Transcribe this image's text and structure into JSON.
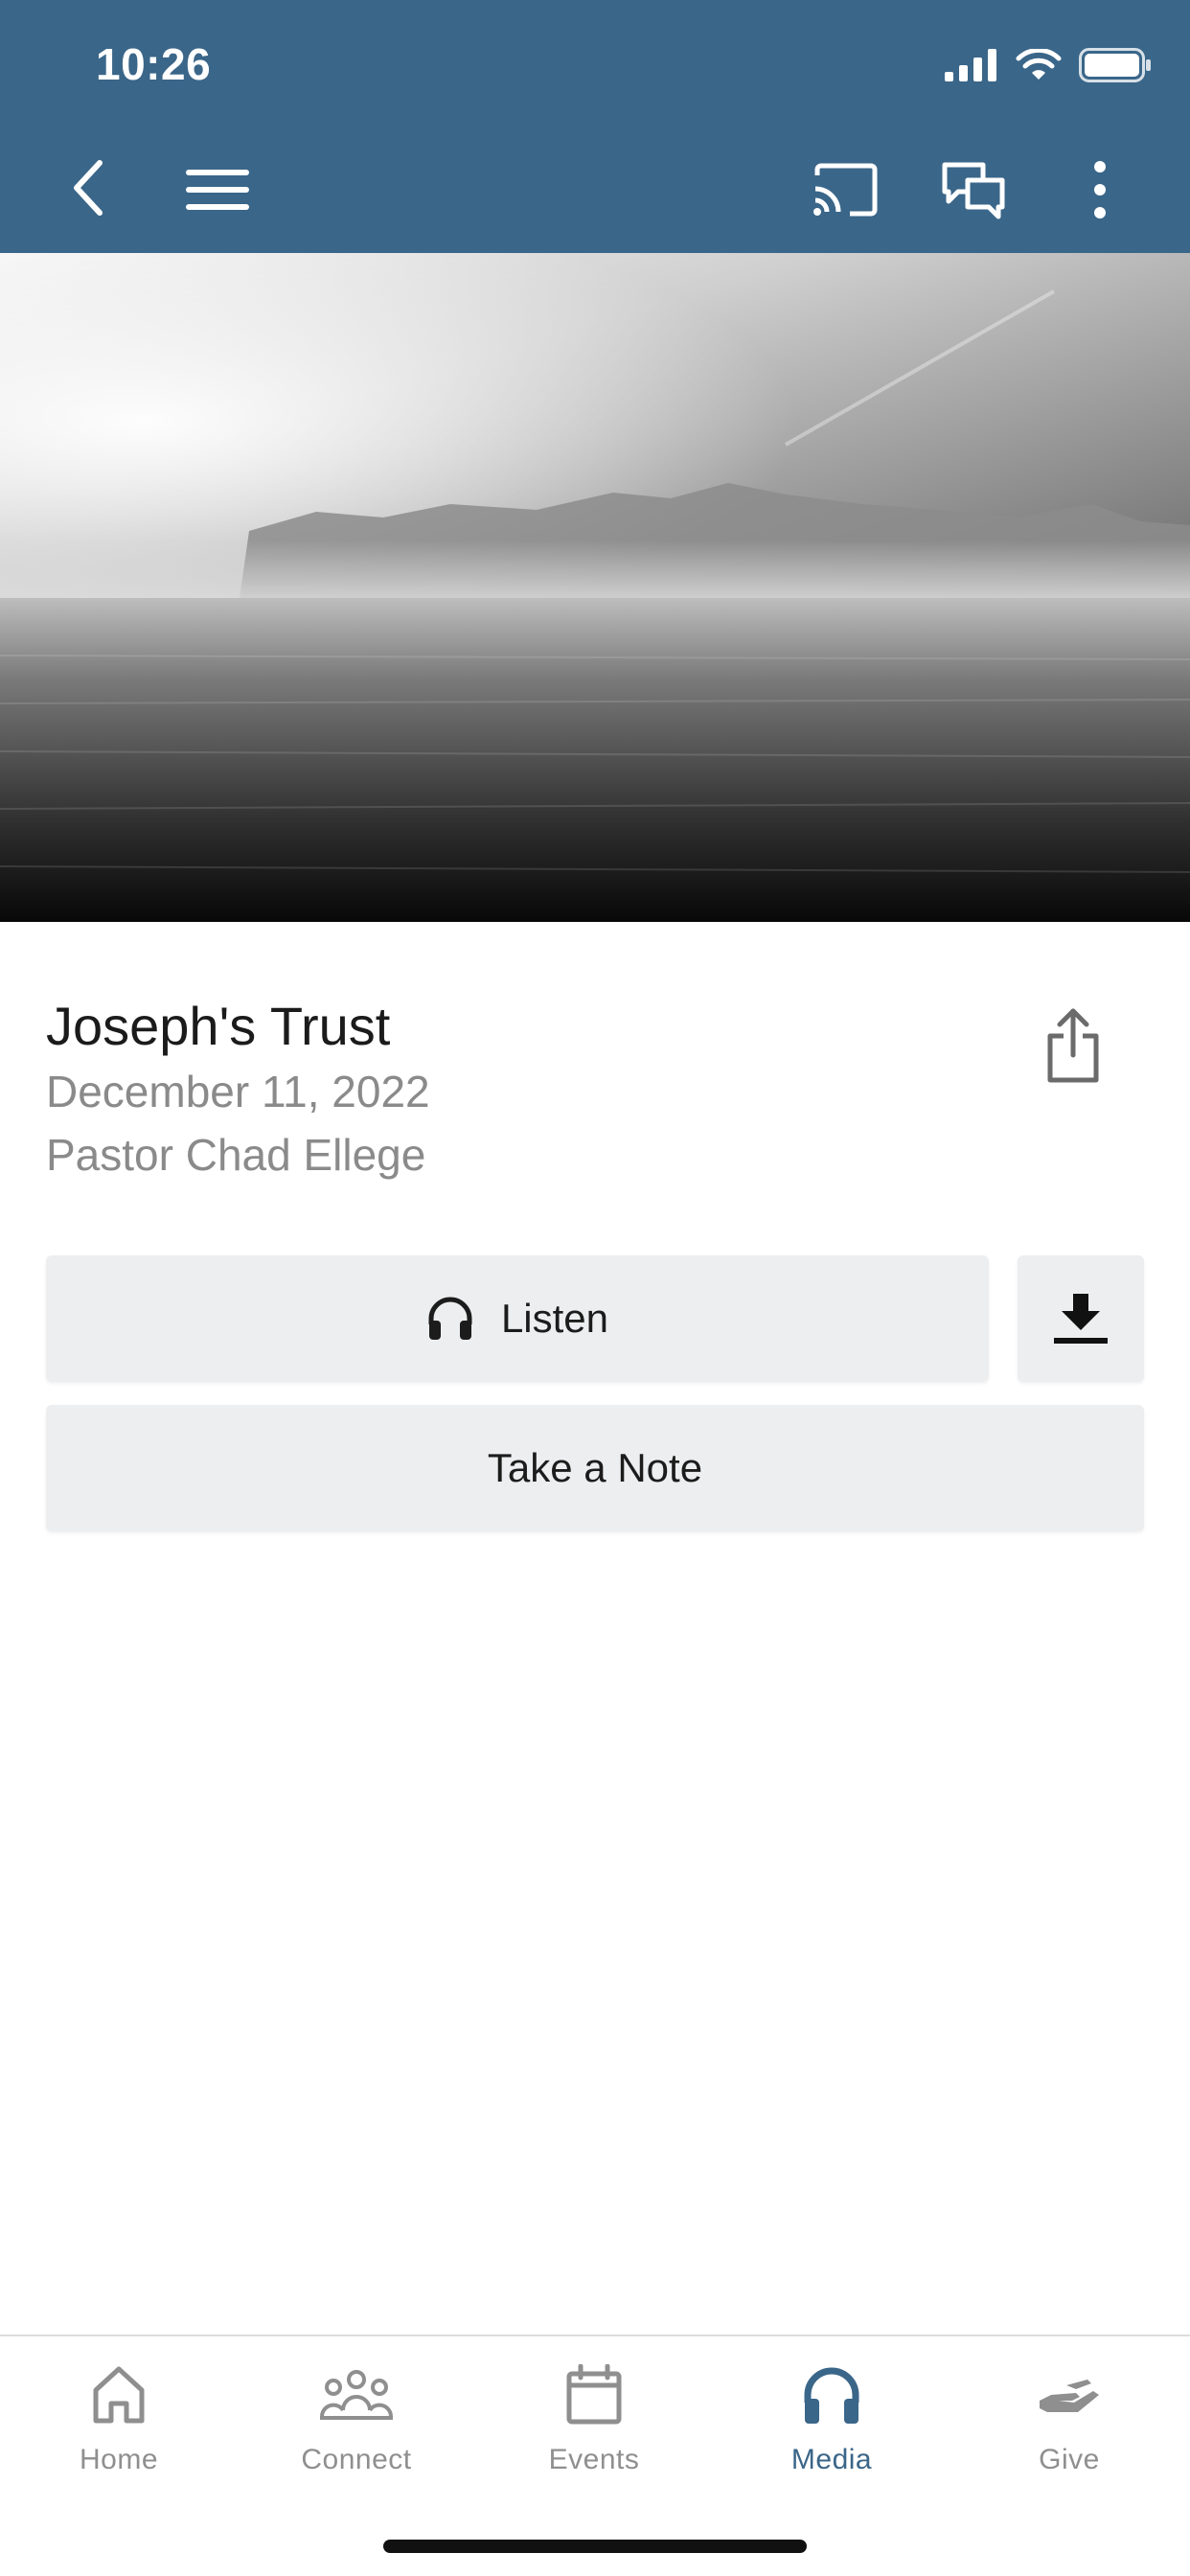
{
  "status_bar": {
    "time": "10:26"
  },
  "colors": {
    "brand": "#3a6689",
    "button_bg": "#edeeef",
    "muted_text": "#8a8a8a",
    "inactive_tab": "#8f8f8f"
  },
  "nav": {
    "icons": [
      "back-icon",
      "menu-icon",
      "cast-icon",
      "chat-icon",
      "more-icon"
    ]
  },
  "hero": {
    "icon": "landscape-image"
  },
  "sermon": {
    "title": "Joseph's Trust",
    "date": "December 11, 2022",
    "speaker": "Pastor Chad Ellege"
  },
  "actions": {
    "listen_label": "Listen",
    "take_note_label": "Take a Note",
    "download_icon": "download-icon",
    "share_icon": "share-icon"
  },
  "tabs": [
    {
      "label": "Home",
      "icon": "home-icon",
      "active": false
    },
    {
      "label": "Connect",
      "icon": "people-icon",
      "active": false
    },
    {
      "label": "Events",
      "icon": "calendar-icon",
      "active": false
    },
    {
      "label": "Media",
      "icon": "headphones-icon",
      "active": true
    },
    {
      "label": "Give",
      "icon": "give-icon",
      "active": false
    }
  ]
}
